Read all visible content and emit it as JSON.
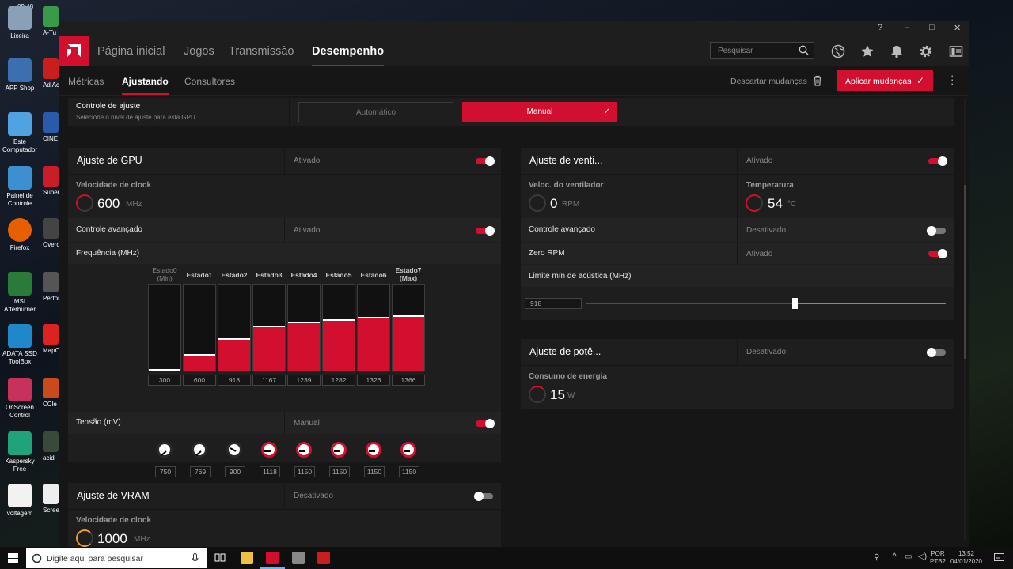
{
  "desktop": {
    "clock_top": "09:48",
    "icons": [
      "Lixeira",
      "APP Shop",
      "Este Computador",
      "Painel de Controle",
      "Firefox",
      "MSI Afterburner",
      "ADATA SSD ToolBox",
      "OnScreen Control",
      "Kaspersky Free",
      "voltagem"
    ],
    "icons_col2": [
      "A-Tu",
      "Ad Acr",
      "CINE Wind",
      "Super Benc",
      "Overcl n",
      "Perfor",
      "MapO",
      "CCle",
      "acid",
      "Screen"
    ]
  },
  "header": {
    "tabs": [
      "Página inicial",
      "Jogos",
      "Transmissão",
      "Desempenho"
    ],
    "search_placeholder": "Pesquisar"
  },
  "subnav": {
    "tabs": [
      "Métricas",
      "Ajustando",
      "Consultores"
    ],
    "discard_label": "Descartar mudanças",
    "apply_label": "Aplicar mudanças"
  },
  "control": {
    "title": "Controle de ajuste",
    "desc": "Selecione o nível de ajuste para esta GPU",
    "auto_label": "Automático",
    "manual_label": "Manual"
  },
  "gpu": {
    "title": "Ajuste de GPU",
    "status": "Ativado",
    "clock_label": "Velocidade de clock",
    "clock_value": "600",
    "clock_unit": "MHz",
    "advanced_label": "Controle avançado",
    "advanced_status": "Ativado",
    "freq_label": "Frequência (MHz)",
    "states": [
      {
        "name": "Estado0",
        "sub": "(Min)",
        "value": "300",
        "level": 0.02
      },
      {
        "name": "Estado1",
        "sub": "",
        "value": "600",
        "level": 0.19
      },
      {
        "name": "Estado2",
        "sub": "",
        "value": "918",
        "level": 0.38
      },
      {
        "name": "Estado3",
        "sub": "",
        "value": "1167",
        "level": 0.53
      },
      {
        "name": "Estado4",
        "sub": "",
        "value": "1239",
        "level": 0.57
      },
      {
        "name": "Estado5",
        "sub": "",
        "value": "1282",
        "level": 0.6
      },
      {
        "name": "Estado6",
        "sub": "",
        "value": "1326",
        "level": 0.63
      },
      {
        "name": "Estado7",
        "sub": "(Max)",
        "value": "1366",
        "level": 0.65
      }
    ],
    "voltage_label": "Tensão (mV)",
    "voltage_status": "Manual",
    "voltages": [
      "750",
      "769",
      "900",
      "1118",
      "1150",
      "1150",
      "1150",
      "1150"
    ]
  },
  "fan": {
    "title": "Ajuste de venti...",
    "status": "Ativado",
    "speed_label": "Veloc. do ventilador",
    "speed_value": "0",
    "speed_unit": "RPM",
    "temp_label": "Temperatura",
    "temp_value": "54",
    "temp_unit": "°C",
    "advanced_label": "Controle avançado",
    "advanced_status": "Desativado",
    "zero_rpm_label": "Zero RPM",
    "zero_rpm_status": "Ativado",
    "acoustic_label": "Limite mín de acústica (MHz)",
    "acoustic_value": "918",
    "acoustic_level": 0.58
  },
  "power": {
    "title": "Ajuste de potê...",
    "status": "Desativado",
    "consumption_label": "Consumo de energia",
    "consumption_value": "15",
    "consumption_unit": "W"
  },
  "vram": {
    "title": "Ajuste de VRAM",
    "status": "Desativado",
    "clock_label": "Velocidade de clock",
    "clock_value": "1000",
    "clock_unit": "MHz"
  },
  "taskbar": {
    "search_placeholder": "Digite aqui para pesquisar",
    "lang1": "POR",
    "lang2": "PTB2",
    "time": "13:52",
    "date": "04/01/2020"
  },
  "colors": {
    "accent": "#d30f2f",
    "panel": "#1e1e1e",
    "background": "#161616"
  }
}
